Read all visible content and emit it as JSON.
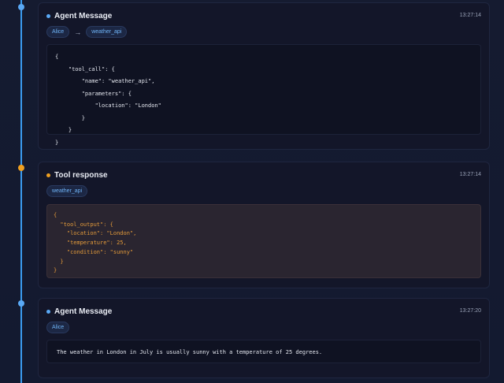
{
  "colors": {
    "timeline": "#3b9cf0",
    "agent_dot": "#5aa9f5",
    "tool_dot": "#f0a020"
  },
  "events": [
    {
      "type": "agent",
      "title": "Agent Message",
      "time": "13:27:14",
      "from": "Alice",
      "arrow": "→",
      "to": "weather_api",
      "content": "{\n    \"tool_call\": {\n        \"name\": \"weather_api\",\n        \"parameters\": {\n            \"location\": \"London\"\n        }\n    }\n}"
    },
    {
      "type": "tool",
      "title": "Tool response",
      "time": "13:27:14",
      "from": "weather_api",
      "content": "{\n  \"tool_output\": {\n    \"location\": \"London\",\n    \"temperature\": 25,\n    \"condition\": \"sunny\"\n  }\n}"
    },
    {
      "type": "agent",
      "title": "Agent Message",
      "time": "13:27:20",
      "from": "Alice",
      "content": "The weather in London in July is usually sunny with a temperature of 25 degrees."
    }
  ]
}
